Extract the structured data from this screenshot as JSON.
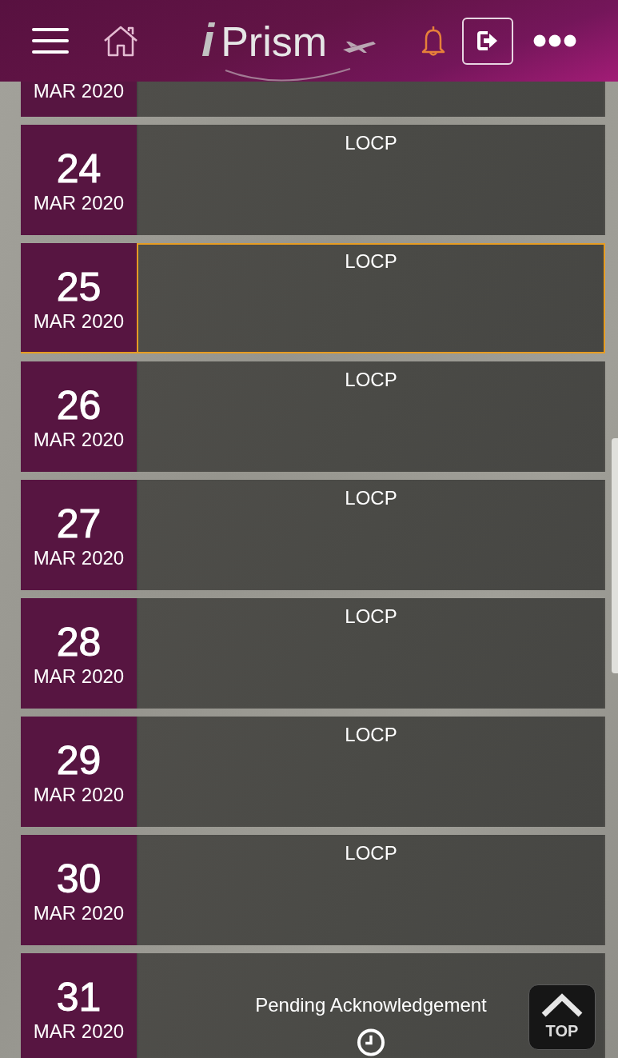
{
  "header": {
    "logo": "iPrism"
  },
  "days": [
    {
      "kind": "partial",
      "month": "MAR 2020",
      "selected": false
    },
    {
      "kind": "duty",
      "day": "24",
      "month": "MAR 2020",
      "entry": "LOCP",
      "selected": false
    },
    {
      "kind": "duty",
      "day": "25",
      "month": "MAR 2020",
      "entry": "LOCP",
      "selected": true
    },
    {
      "kind": "duty",
      "day": "26",
      "month": "MAR 2020",
      "entry": "LOCP",
      "selected": false
    },
    {
      "kind": "duty",
      "day": "27",
      "month": "MAR 2020",
      "entry": "LOCP",
      "selected": false
    },
    {
      "kind": "duty",
      "day": "28",
      "month": "MAR 2020",
      "entry": "LOCP",
      "selected": false
    },
    {
      "kind": "duty",
      "day": "29",
      "month": "MAR 2020",
      "entry": "LOCP",
      "selected": false
    },
    {
      "kind": "duty",
      "day": "30",
      "month": "MAR 2020",
      "entry": "LOCP",
      "selected": false
    },
    {
      "kind": "pending",
      "day": "31",
      "month": "MAR 2020",
      "entry": "Pending Acknowledgement",
      "selected": false
    }
  ],
  "top_button": {
    "label": "TOP"
  }
}
